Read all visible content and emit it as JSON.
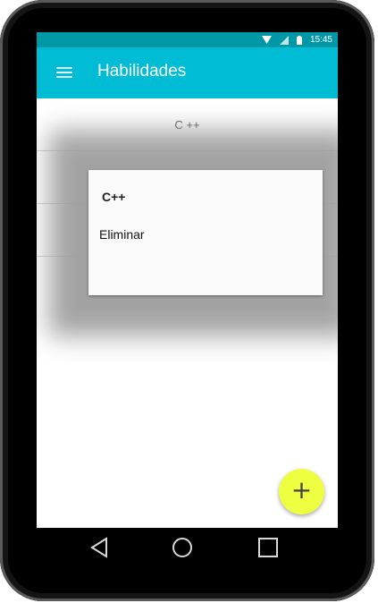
{
  "status_bar": {
    "time": "15:45"
  },
  "app_bar": {
    "title": "Habilidades",
    "menu_icon": "hamburger-menu-icon"
  },
  "list": {
    "items": [
      {
        "label": "C ++"
      }
    ]
  },
  "dialog": {
    "title": "C++",
    "options": [
      {
        "label": "Eliminar"
      }
    ]
  },
  "fab": {
    "label": "+",
    "color": "#eeff41"
  },
  "nav_bar": {
    "icons": [
      "back-icon",
      "home-icon",
      "recents-icon"
    ]
  },
  "colors": {
    "primary": "#00bcd4",
    "primary_dark": "#0097a7",
    "accent": "#eeff41"
  }
}
